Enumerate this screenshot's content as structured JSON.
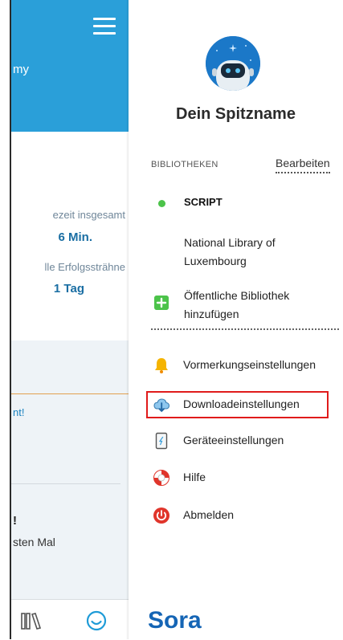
{
  "background": {
    "header_text": "my",
    "stats": {
      "label1": "ezeit insgesamt",
      "value1": "6 Min.",
      "label2": "lle Erfolgssträhne",
      "value2": "1 Tag"
    },
    "link_text": "nt!",
    "exclamation": "!",
    "bottom_text": "sten Mal"
  },
  "drawer": {
    "nickname": "Dein Spitzname",
    "libraries_heading": "BIBLIOTHEKEN",
    "edit_label": "Bearbeiten",
    "active_library": "SCRIPT",
    "library_name": "National Library of Luxembourg",
    "add_library": "Öffentliche Bibliothek hinzufügen",
    "menu": [
      {
        "label": "Vormerkungseinstellungen",
        "icon": "bell-icon"
      },
      {
        "label": "Downloadeinstellungen",
        "icon": "cloud-download-icon"
      },
      {
        "label": "Geräteeinstellungen",
        "icon": "device-icon"
      },
      {
        "label": "Hilfe",
        "icon": "lifebuoy-icon"
      },
      {
        "label": "Abmelden",
        "icon": "power-icon"
      }
    ],
    "brand": "Sora"
  },
  "colors": {
    "header_blue": "#2a9fd9",
    "active_green": "#4cc34a",
    "highlight_red": "#e01b1b",
    "brand_blue": "#1565b5"
  }
}
